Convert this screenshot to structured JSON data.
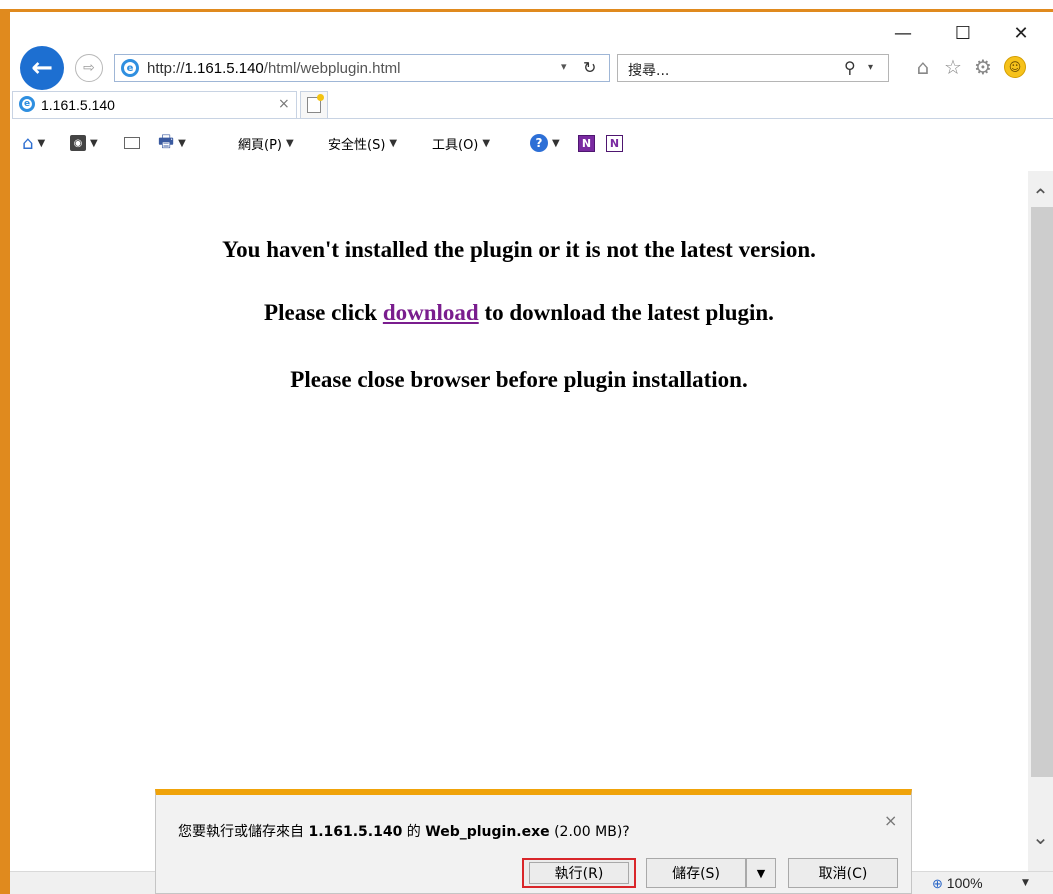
{
  "window": {
    "minimize_glyph": "—",
    "maximize_glyph": "☐",
    "close_glyph": "✕"
  },
  "address_bar": {
    "url_scheme": "http://",
    "url_host": "1.161.5.140",
    "url_path": "/html/webplugin.html",
    "dropdown_glyph": "▾",
    "refresh_glyph": "↻"
  },
  "search": {
    "placeholder": "搜尋..."
  },
  "tab": {
    "title": "1.161.5.140",
    "close_glyph": "×"
  },
  "command_bar": {
    "page_label": "網頁(P)",
    "safety_label": "安全性(S)",
    "tools_label": "工具(O)",
    "icons": [
      "home-icon",
      "feeds-icon",
      "mail-icon",
      "print-icon",
      "help-icon",
      "onenote-icon",
      "onenote-linked-icon"
    ]
  },
  "content": {
    "line1": "You haven't installed the plugin or it is not the latest version.",
    "line2_prefix": "Please click ",
    "line2_link": "download",
    "line2_suffix": " to download the latest plugin.",
    "line3": "Please close browser before plugin installation."
  },
  "notification": {
    "prompt_prefix": "您要執行或儲存來自 ",
    "prompt_host": "1.161.5.140",
    "prompt_mid": " 的 ",
    "prompt_file": "Web_plugin.exe",
    "prompt_size": " (2.00 MB)?",
    "run_label": "執行(R)",
    "save_label": "儲存(S)",
    "cancel_label": "取消(C)",
    "close_glyph": "×"
  },
  "status_bar": {
    "zoom_label": "100%"
  },
  "colors": {
    "frame_accent": "#e08a1e",
    "notification_bar": "#f0a30a",
    "link_visited": "#7a1d8e",
    "run_button_highlight": "#d9262a"
  }
}
